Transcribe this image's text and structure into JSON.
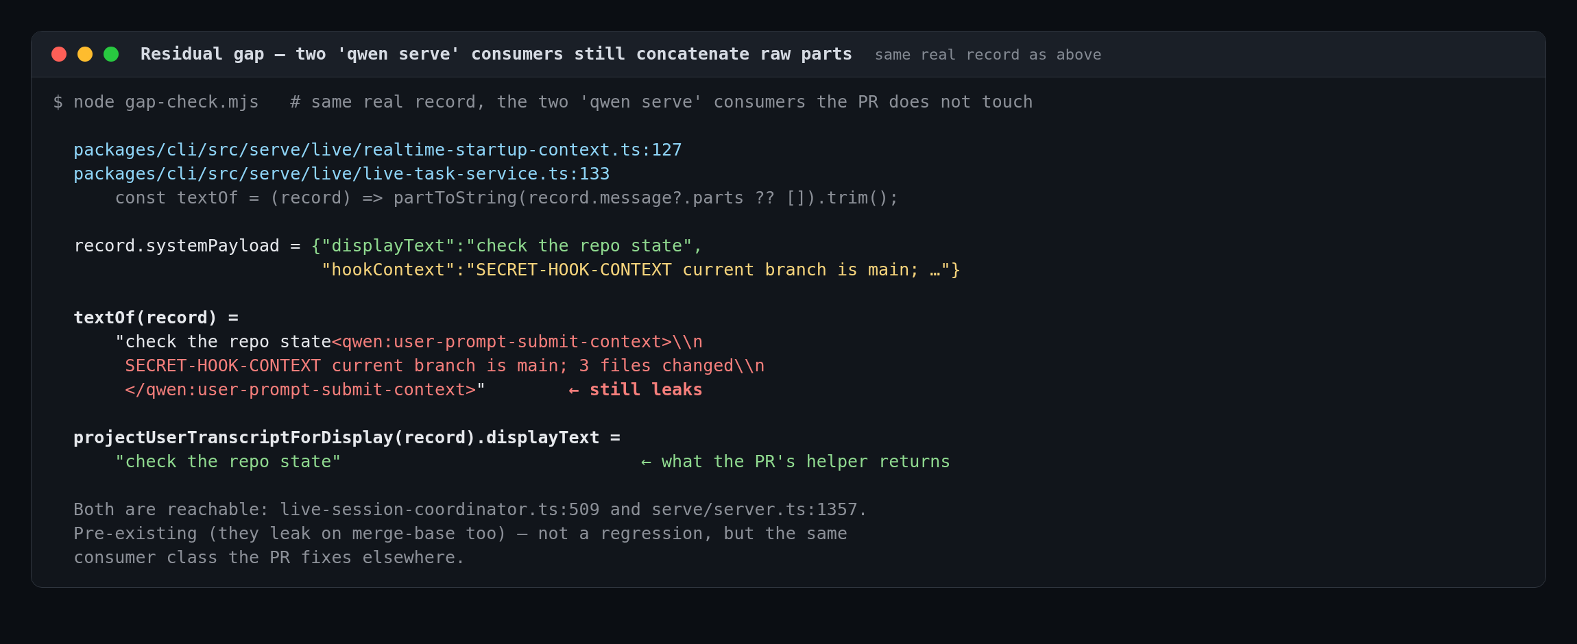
{
  "window": {
    "title": "Residual gap — two 'qwen serve' consumers still concatenate raw parts",
    "subtitle": "same real record as above"
  },
  "command": {
    "prompt": "$ node gap-check.mjs",
    "comment": "# same real record, the two 'qwen serve' consumers the PR does not touch"
  },
  "files": [
    "packages/cli/src/serve/live/realtime-startup-context.ts:127",
    "packages/cli/src/serve/live/live-task-service.ts:133"
  ],
  "code_line": "const textOf = (record) => partToString(record.message?.parts ?? []).trim();",
  "payload": {
    "label": "record.systemPayload =",
    "line_1": "{\"displayText\":\"check the repo state\",",
    "line_2": "\"hookContext\":\"SECRET-HOOK-CONTEXT current branch is main; …\"}"
  },
  "text_of": {
    "heading": "textOf(record) =",
    "line_1_plain": "\"check the repo state",
    "line_1_leak": "<qwen:user-prompt-submit-context>\\\\n",
    "line_2_leak": "SECRET-HOOK-CONTEXT current branch is main; 3 files changed\\\\n",
    "line_3_leak": "</qwen:user-prompt-submit-context>",
    "line_3_plain": "\"",
    "note": "← still leaks"
  },
  "projection": {
    "heading": "projectUserTranscriptForDisplay(record).displayText =",
    "value": "\"check the repo state\"",
    "note": "← what the PR's helper returns"
  },
  "footer": [
    "Both are reachable: live-session-coordinator.ts:509 and serve/server.ts:1357.",
    "Pre-existing (they leak on merge-base too) — not a regression, but the same",
    "consumer class the PR fixes elsewhere."
  ]
}
